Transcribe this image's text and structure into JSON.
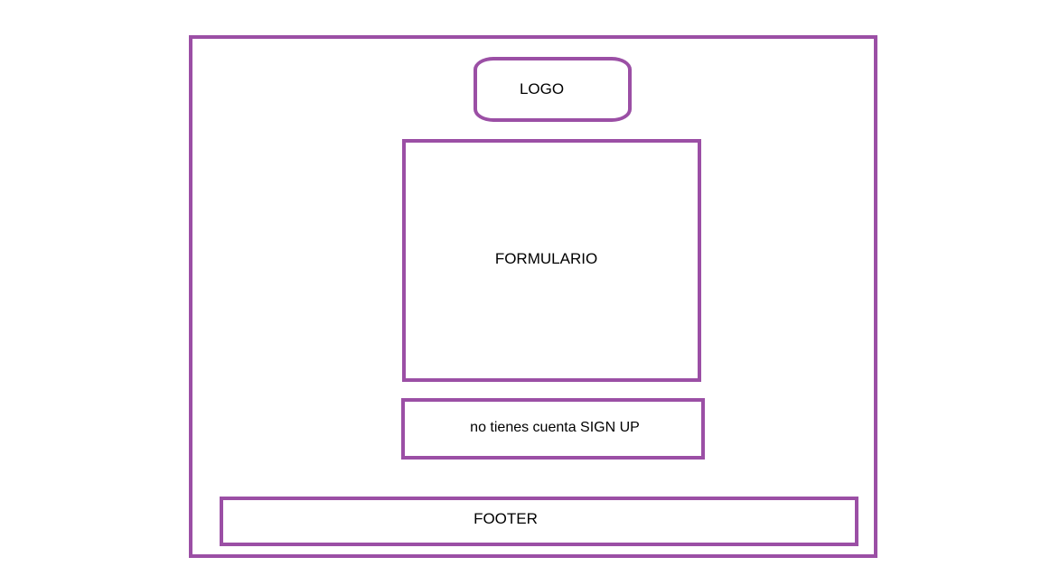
{
  "colors": {
    "border": "#9b4fa5",
    "background": "#ffffff",
    "text": "#000000"
  },
  "labels": {
    "logo": "LOGO",
    "form": "FORMULARIO",
    "signup": "no tienes cuenta SIGN UP",
    "footer": "FOOTER"
  }
}
